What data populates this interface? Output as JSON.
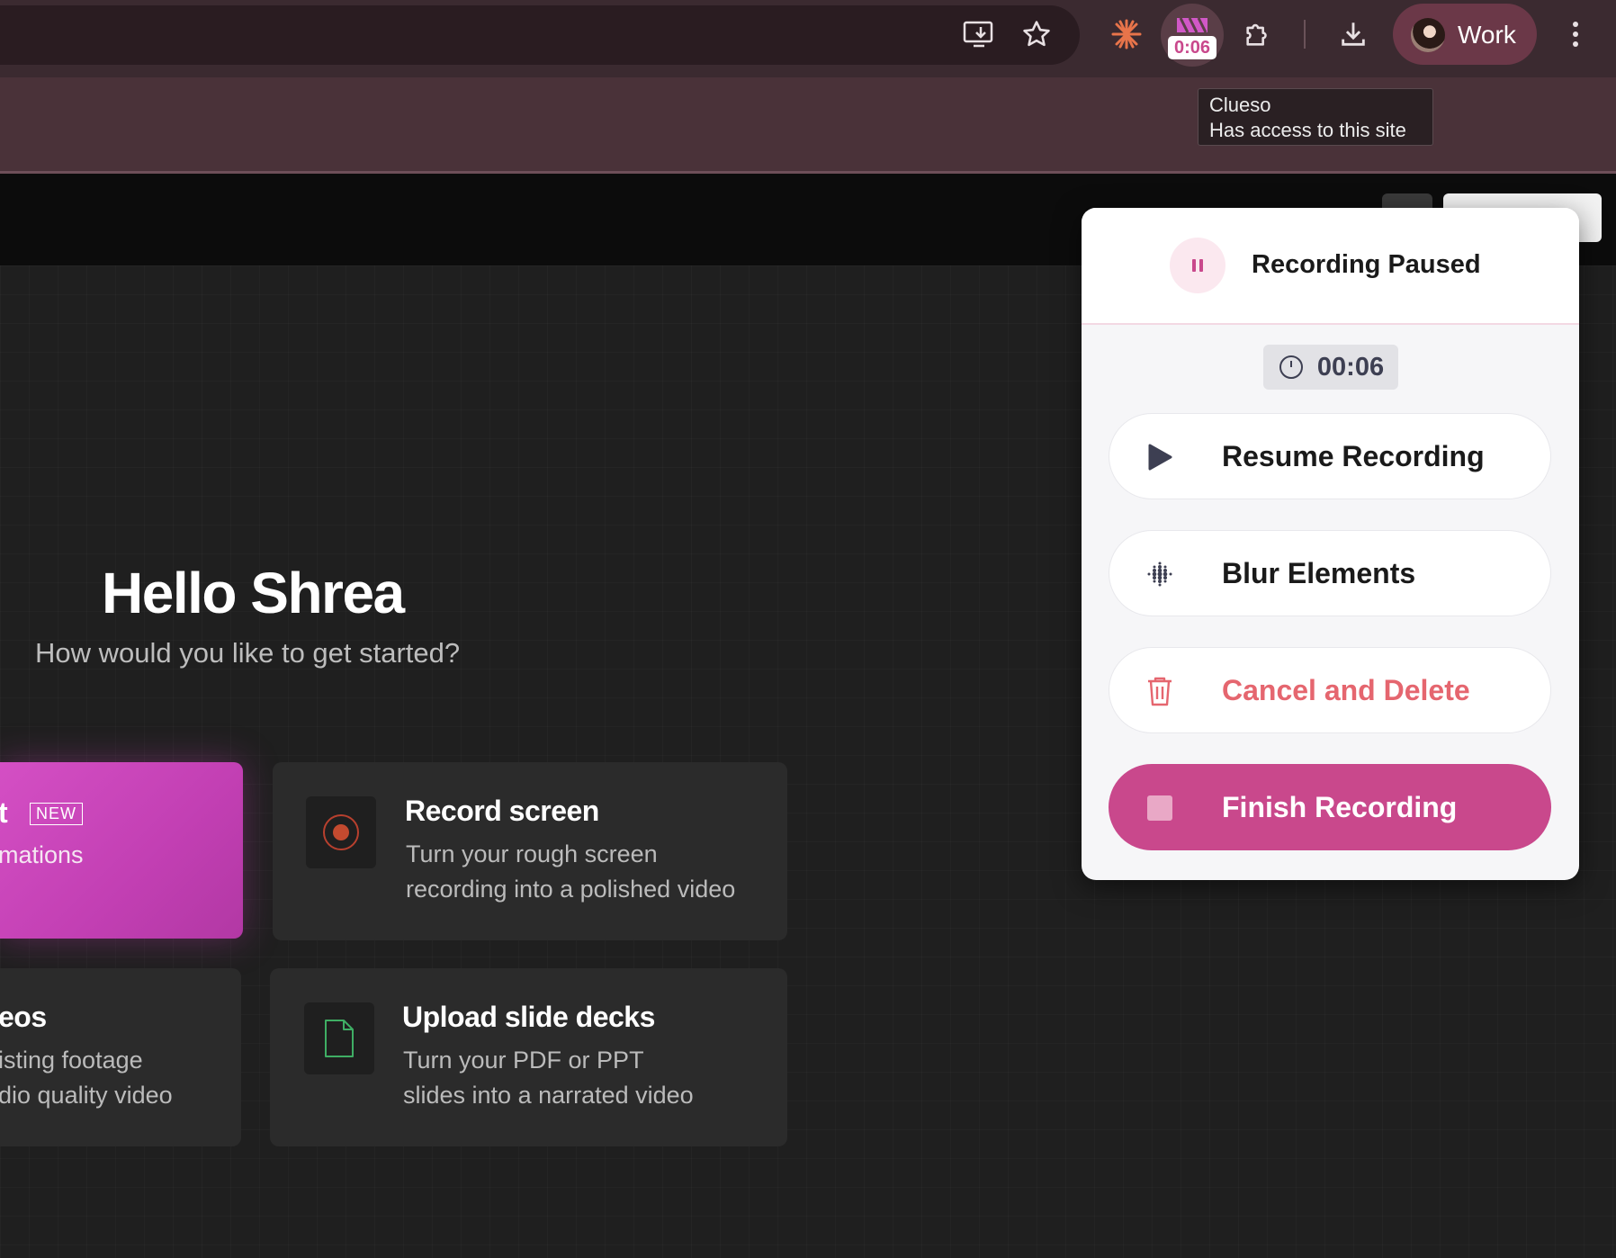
{
  "browser": {
    "extension_badge_time": "0:06",
    "profile_label": "Work",
    "tooltip": {
      "title": "Clueso",
      "subtitle": "Has access to this site"
    }
  },
  "page": {
    "greeting": "Hello Shrea",
    "subtitle": "How would you like to get started?",
    "cards": {
      "ai": {
        "title_fragment": "t",
        "badge": "NEW",
        "desc_fragment": "mations"
      },
      "record": {
        "title": "Record screen",
        "desc_line1": "Turn your rough screen",
        "desc_line2": "recording into a polished video"
      },
      "videos": {
        "title_fragment": "eos",
        "desc_line1": "isting footage",
        "desc_line2": "dio quality video"
      },
      "slides": {
        "title": "Upload slide decks",
        "desc_line1": "Turn your PDF or PPT",
        "desc_line2": "slides into a narrated video"
      }
    }
  },
  "popup": {
    "status": "Recording Paused",
    "timer": "00:06",
    "buttons": {
      "resume": "Resume Recording",
      "blur": "Blur Elements",
      "cancel": "Cancel and Delete",
      "finish": "Finish Recording"
    }
  },
  "icons": {
    "install": "install-app-icon",
    "star": "bookmark-star-icon",
    "sparkle": "sparkle-extension-icon",
    "clapper": "clapperboard-extension-icon",
    "puzzle": "extensions-puzzle-icon",
    "download": "download-icon",
    "menu": "kebab-menu-icon",
    "pause": "pause-icon",
    "clock": "clock-icon",
    "play": "play-icon",
    "blur": "blur-dots-icon",
    "trash": "trash-icon",
    "stop": "stop-square-icon",
    "record": "record-icon",
    "file": "file-icon"
  },
  "colors": {
    "accent_pink": "#c9488c",
    "danger": "#e5666f",
    "ai_card": "#c23fb3",
    "toolbar": "#3b2a30"
  }
}
